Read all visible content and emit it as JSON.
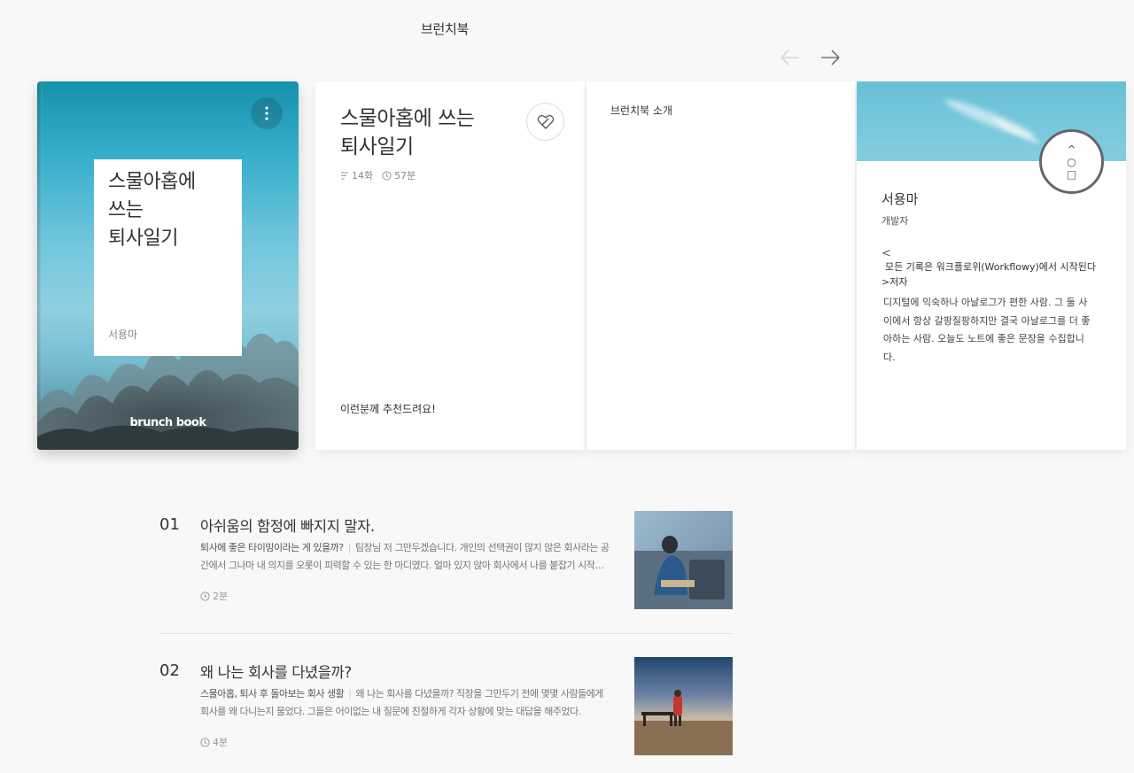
{
  "section": {
    "title": "브런치북"
  },
  "icons": {
    "prev": "arrow-left-icon",
    "next": "arrow-right-icon",
    "more": "more-vertical-icon",
    "like": "heart-broken-icon",
    "episodes": "list-icon",
    "time": "clock-icon"
  },
  "book": {
    "cover_title": "스물아홉에\n쓰는\n퇴사일기",
    "cover_author": "서용마",
    "brand": "brunch book",
    "title": "스물아홉에 쓰는\n퇴사일기",
    "episodes": "14화",
    "duration": "57분",
    "recommend_heading": "이런분께 추천드려요!"
  },
  "intro": {
    "heading": "브런치북 소개"
  },
  "floater": {
    "up": "^",
    "mid": "○",
    "bottom": "□"
  },
  "author": {
    "name": "서용마",
    "role": "개발자",
    "chev_left": "<",
    "link_text": "모든 기록은 워크플로위(Workflowy)에서 시작된다",
    "chev_right": ">",
    "link_suffix": "저자",
    "description": "디지털에 익숙하나 아날로그가 편한 사람. 그 둘 사이에서 항상 갈팡질팡하지만 결국 아날로그를 더 좋아하는 사람. 오늘도 노트에 좋은 문장을 수집합니다."
  },
  "articles": [
    {
      "num": "01",
      "title": "아쉬움의 함정에 빠지지 말자.",
      "subtitle": "퇴사에 좋은 타이밍이라는 게 있을까?",
      "excerpt": "팀장님 저 그만두겠습니다. 개인의 선택권이 많지 않은 회사라는 공간에서 그나마 내 의지를 오롯이 피력할 수 있는 한 마디였다. 얼마 있지 않아 회사에서 나를 붙잡기 시작했다.",
      "time": "2분"
    },
    {
      "num": "02",
      "title": "왜 나는 회사를 다녔을까?",
      "subtitle": "스물아홉, 퇴사 후 돌아보는 회사 생활",
      "excerpt": "왜 나는 회사를 다녔을까? 직장을 그만두기 전에 몇몇 사람들에게 회사를 왜 다니는지 물었다. 그들은 어이없는 내 질문에 친절하게 각자 상황에 맞는 대답을 해주었다.",
      "time": "4분"
    }
  ]
}
